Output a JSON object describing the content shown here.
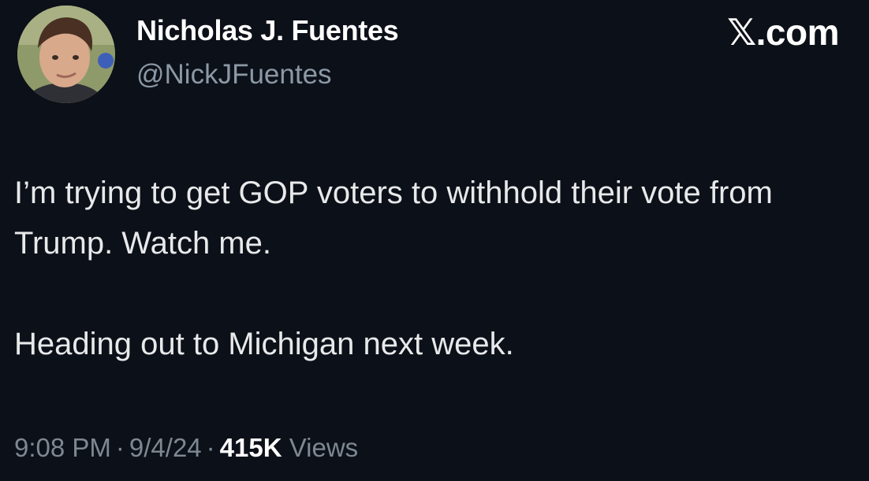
{
  "author": {
    "display_name": "Nicholas J. Fuentes",
    "handle": "@NickJFuentes",
    "avatar_icon": "profile-photo-icon"
  },
  "brand": {
    "label": ".com",
    "glyph": "𝕏"
  },
  "tweet": {
    "line1": "I’m trying to get GOP voters to withhold their vote from Trump. Watch me.",
    "line2": "Heading out to Michigan next week."
  },
  "meta": {
    "time": "9:08 PM",
    "separator": "·",
    "date": "9/4/24",
    "views_count": "415K",
    "views_label": "Views"
  },
  "colors": {
    "background": "#0c1018",
    "text": "#e7e9ea",
    "muted": "#8b98a5"
  }
}
